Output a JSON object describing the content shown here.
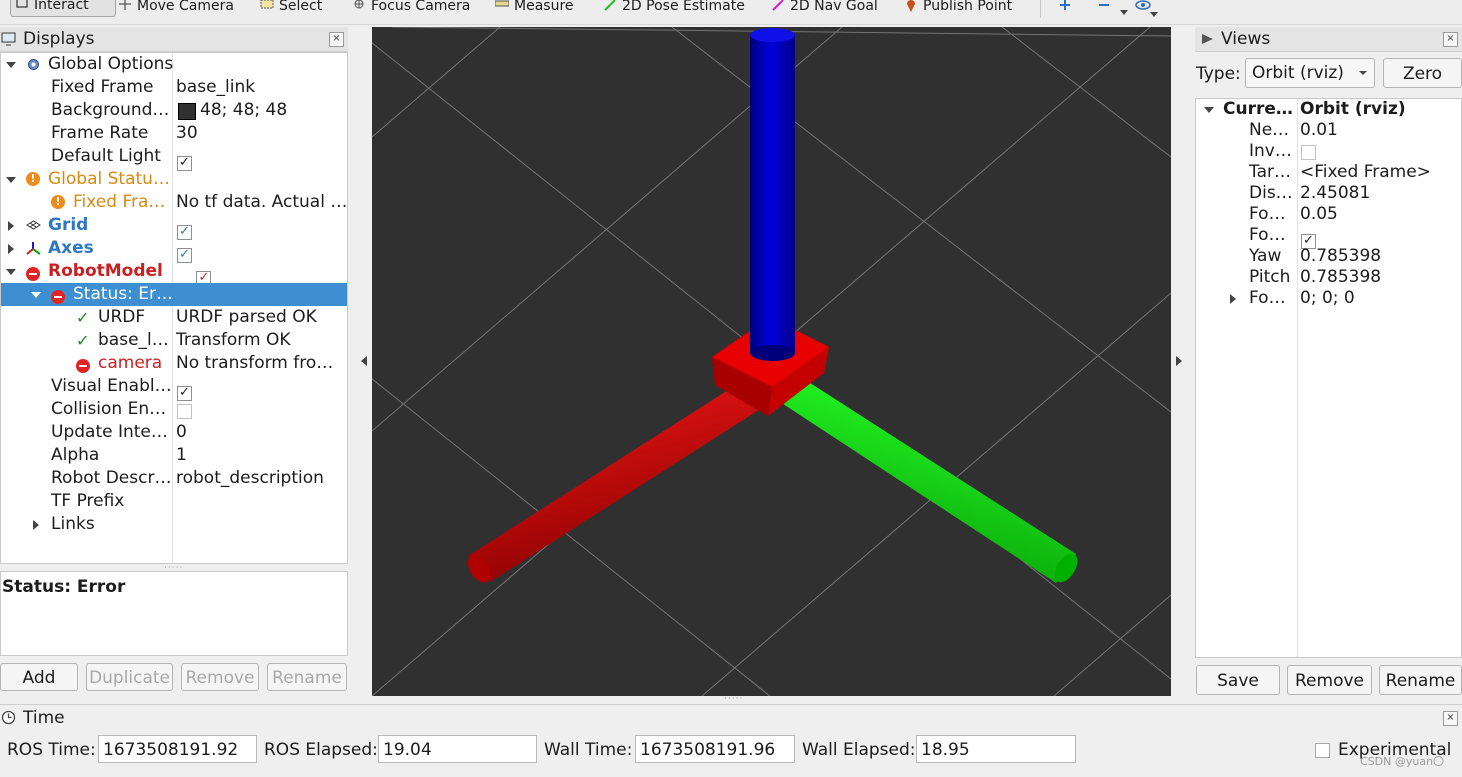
{
  "toolbar": {
    "items": [
      {
        "label": "Interact",
        "icon": "cursor-icon"
      },
      {
        "label": "Move Camera",
        "icon": "move-camera-icon"
      },
      {
        "label": "Select",
        "icon": "select-icon"
      },
      {
        "label": "Focus Camera",
        "icon": "focus-camera-icon"
      },
      {
        "label": "Measure",
        "icon": "measure-icon"
      },
      {
        "label": "2D Pose Estimate",
        "icon": "pose-estimate-icon"
      },
      {
        "label": "2D Nav Goal",
        "icon": "nav-goal-icon"
      },
      {
        "label": "Publish Point",
        "icon": "publish-point-icon"
      }
    ]
  },
  "displays": {
    "title": "Displays",
    "rows": [
      {
        "name": "Global Options",
        "value": ""
      },
      {
        "name": "Fixed Frame",
        "value": "base_link"
      },
      {
        "name": "Background…",
        "value": "48; 48; 48"
      },
      {
        "name": "Frame Rate",
        "value": "30"
      },
      {
        "name": "Default Light",
        "value": ""
      },
      {
        "name": "Global Statu…",
        "value": ""
      },
      {
        "name": "Fixed Fra…",
        "value": "No tf data.  Actual …"
      },
      {
        "name": "Grid",
        "value": ""
      },
      {
        "name": "Axes",
        "value": ""
      },
      {
        "name": "RobotModel",
        "value": ""
      },
      {
        "name": "Status: Er…",
        "value": ""
      },
      {
        "name": "URDF",
        "value": "URDF parsed OK"
      },
      {
        "name": "base_l…",
        "value": "Transform OK"
      },
      {
        "name": "camera",
        "value": "No transform fro…"
      },
      {
        "name": "Visual Enabl…",
        "value": ""
      },
      {
        "name": "Collision En…",
        "value": ""
      },
      {
        "name": "Update Inte…",
        "value": "0"
      },
      {
        "name": "Alpha",
        "value": "1"
      },
      {
        "name": "Robot Descr…",
        "value": "robot_description"
      },
      {
        "name": "TF Prefix",
        "value": ""
      },
      {
        "name": "Links",
        "value": ""
      }
    ],
    "status_text": "Status: Error",
    "buttons": {
      "add": "Add",
      "duplicate": "Duplicate",
      "remove": "Remove",
      "rename": "Rename"
    }
  },
  "views": {
    "title": "Views",
    "type_label": "Type:",
    "type_value": "Orbit (rviz)",
    "zero_button": "Zero",
    "rows": [
      {
        "name": "Curre…",
        "value": "Orbit (rviz)"
      },
      {
        "name": "Ne…",
        "value": "0.01"
      },
      {
        "name": "Inv…",
        "value": ""
      },
      {
        "name": "Tar…",
        "value": "<Fixed Frame>"
      },
      {
        "name": "Dis…",
        "value": "2.45081"
      },
      {
        "name": "Fo…",
        "value": "0.05"
      },
      {
        "name": "Fo…",
        "value": ""
      },
      {
        "name": "Yaw",
        "value": "0.785398"
      },
      {
        "name": "Pitch",
        "value": "0.785398"
      },
      {
        "name": "Fo…",
        "value": "0; 0; 0"
      }
    ],
    "buttons": {
      "save": "Save",
      "remove": "Remove",
      "rename": "Rename"
    }
  },
  "time": {
    "title": "Time",
    "ros_time_label": "ROS Time:",
    "ros_time": "1673508191.92",
    "ros_elapsed_label": "ROS Elapsed:",
    "ros_elapsed": "19.04",
    "wall_time_label": "Wall Time:",
    "wall_time": "1673508191.96",
    "wall_elapsed_label": "Wall Elapsed:",
    "wall_elapsed": "18.95",
    "experimental_label": "Experimental"
  },
  "watermark": "CSDN @yuan〇",
  "colors": {
    "viewport_bg": "#303030",
    "selection": "#3d8fd1",
    "x_axis": "#dd0000",
    "y_axis": "#00cc00",
    "z_axis": "#0000cc",
    "error_text": "#cc1f1f",
    "warn_text": "#d88a10",
    "link_text": "#2e78c2"
  }
}
